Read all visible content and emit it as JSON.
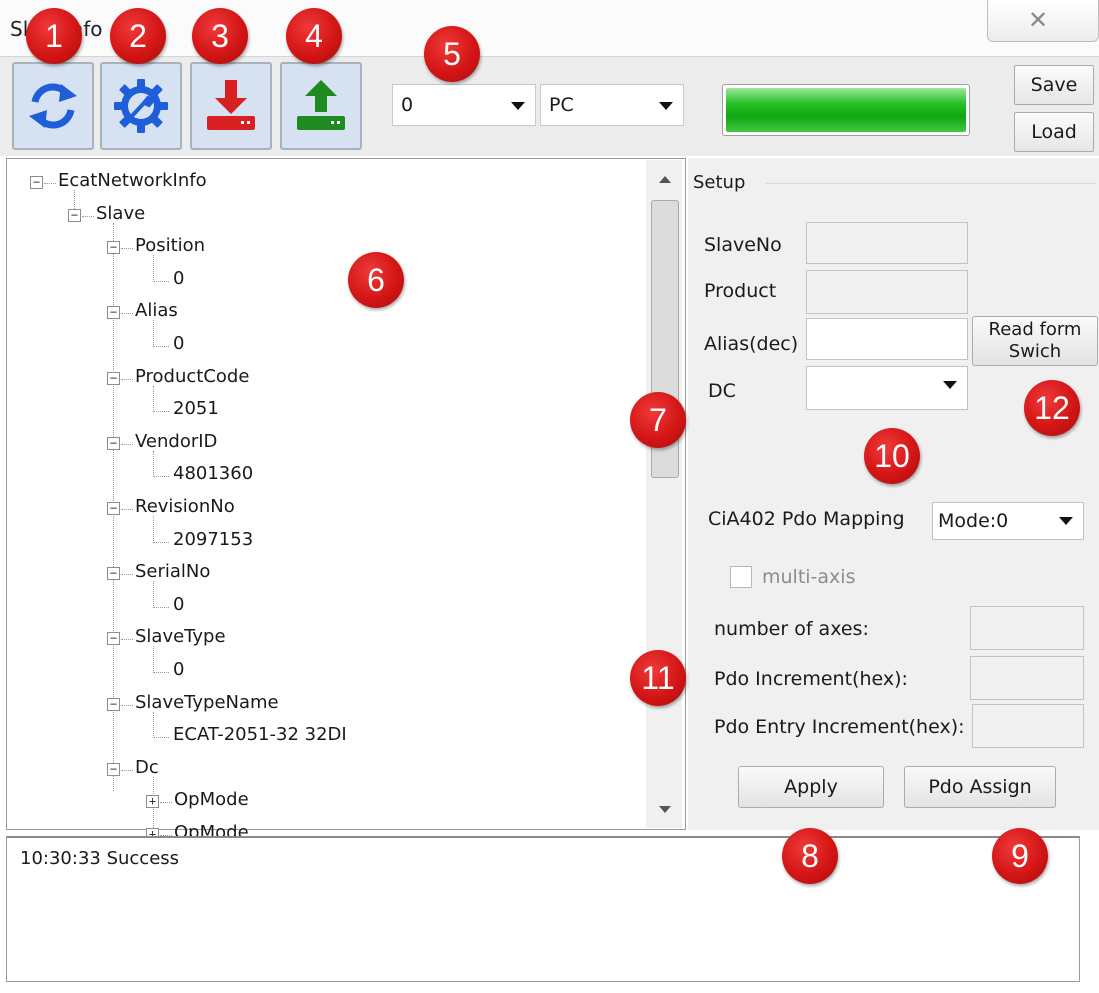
{
  "window": {
    "title": "SlaveInfo",
    "close_icon": "close-icon"
  },
  "toolbar": {
    "buttons": [
      {
        "name": "refresh",
        "icon": "refresh-icon",
        "color": "#1e5fd9"
      },
      {
        "name": "settings",
        "icon": "gear-wrench-icon",
        "color": "#1e5fd9"
      },
      {
        "name": "download",
        "icon": "download-icon",
        "color": "#d92020"
      },
      {
        "name": "upload",
        "icon": "upload-icon",
        "color": "#1f8a1f"
      }
    ],
    "combo_index": "0",
    "combo_source": "PC",
    "progress": 1.0,
    "progress_color": "#1db51d",
    "save_label": "Save",
    "load_label": "Load"
  },
  "tree": {
    "root": "EcatNetworkInfo",
    "slave": "Slave",
    "nodes": [
      {
        "label": "Position",
        "value": "0"
      },
      {
        "label": "Alias",
        "value": "0"
      },
      {
        "label": "ProductCode",
        "value": "2051"
      },
      {
        "label": "VendorID",
        "value": "4801360"
      },
      {
        "label": "RevisionNo",
        "value": "2097153"
      },
      {
        "label": "SerialNo",
        "value": "0"
      },
      {
        "label": "SlaveType",
        "value": "0"
      },
      {
        "label": "SlaveTypeName",
        "value": "ECAT-2051-32 32DI"
      }
    ],
    "dc": "Dc",
    "dc_children": [
      "OpMode",
      "OpMode"
    ]
  },
  "setup": {
    "group_label": "Setup",
    "slave_no_label": "SlaveNo",
    "slave_no_value": "",
    "product_label": "Product",
    "product_value": "",
    "alias_label": "Alias(dec)",
    "alias_value": "",
    "read_switch_label_1": "Read form",
    "read_switch_label_2": "Swich",
    "dc_label": "DC",
    "dc_value": "",
    "pdo_mapping_label": "CiA402 Pdo Mapping",
    "pdo_mapping_value": "Mode:0",
    "multi_axis_label": "multi-axis",
    "multi_axis_checked": false,
    "num_axes_label": "number of axes:",
    "pdo_increment_label": "Pdo Increment(hex):",
    "pdo_entry_increment_label": "Pdo Entry Increment(hex):",
    "apply_label": "Apply",
    "pdo_assign_label": "Pdo Assign"
  },
  "log": {
    "text": "10:30:33  Success"
  },
  "callouts": [
    "1",
    "2",
    "3",
    "4",
    "5",
    "6",
    "7",
    "8",
    "9",
    "10",
    "11",
    "12"
  ],
  "badge_color": "#d31515"
}
